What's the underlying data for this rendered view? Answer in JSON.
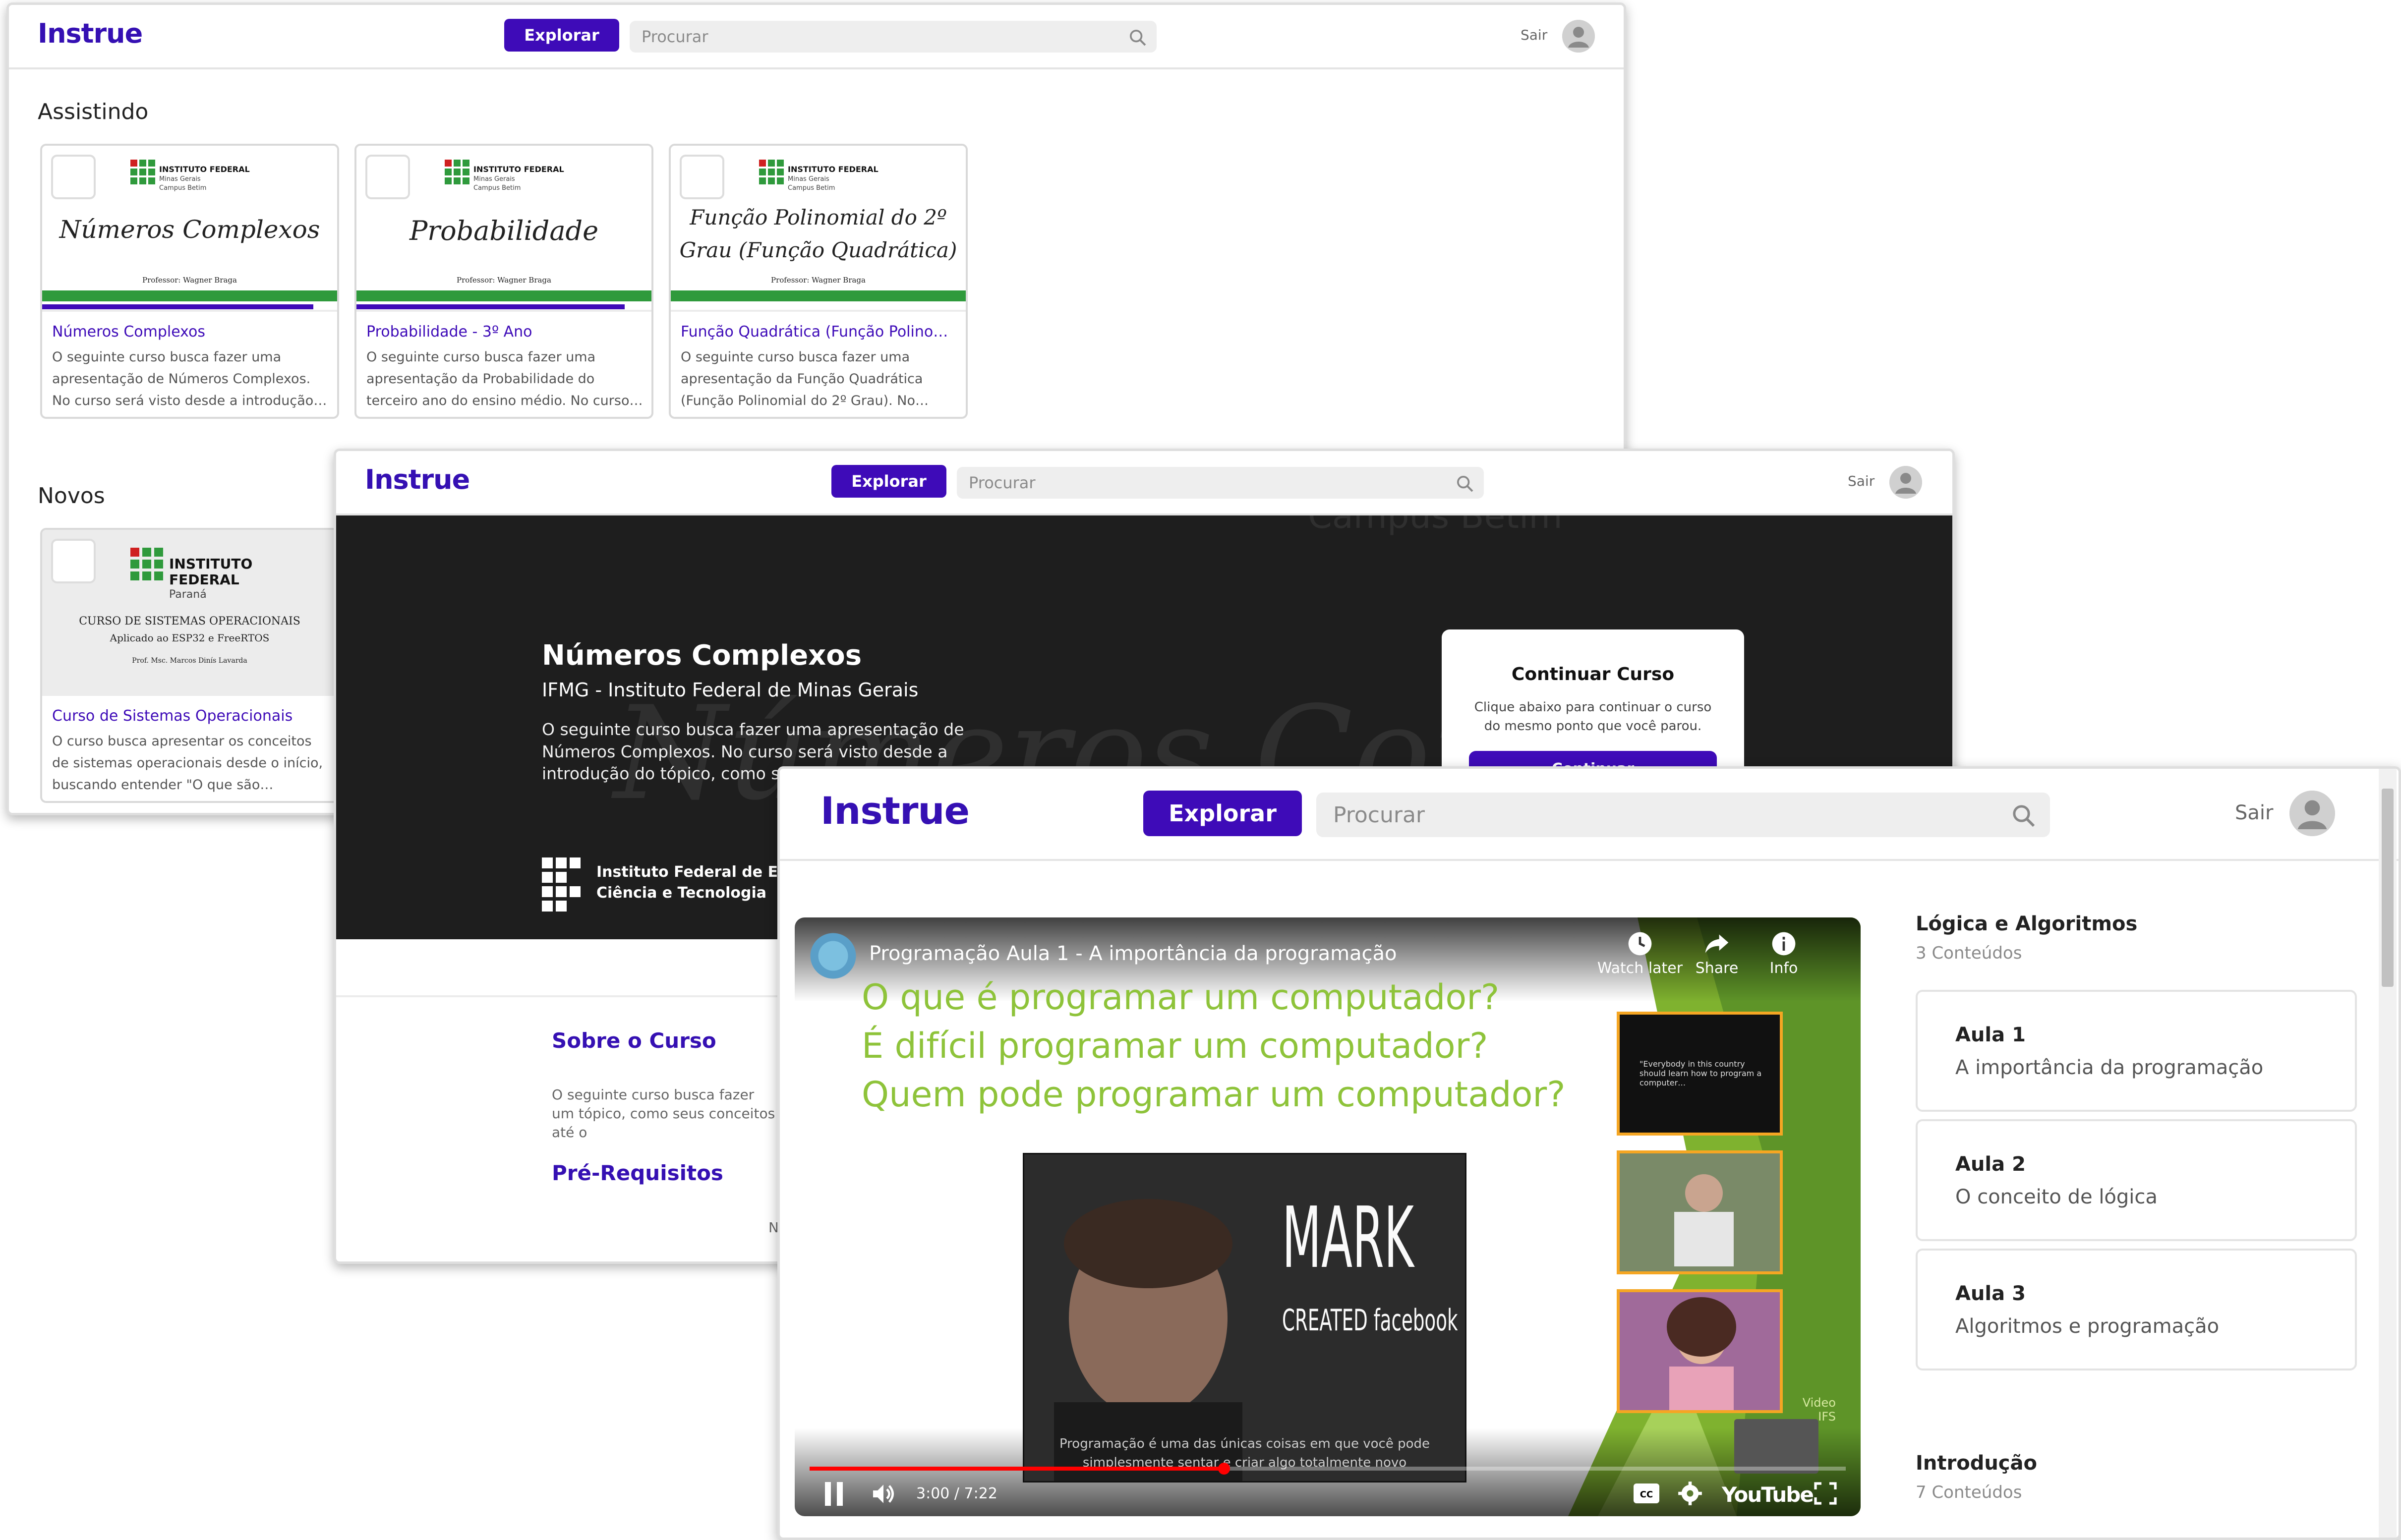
{
  "app": {
    "brand": "Instrue",
    "explore_label": "Explorar",
    "search_placeholder": "Procurar",
    "logout_label": "Sair"
  },
  "home": {
    "watching_title": "Assistindo",
    "new_title": "Novos",
    "watching": [
      {
        "thumb_title": "Números Complexos",
        "thumb_prof": "Professor: Wagner Braga",
        "title": "Números Complexos",
        "description": "O seguinte curso busca fazer uma apresentação de Números Complexos. No curso será visto desde a introdução…",
        "progress": 0.92
      },
      {
        "thumb_title": "Probabilidade",
        "thumb_prof": "Professor: Wagner Braga",
        "title": "Probabilidade - 3º Ano",
        "description": "O seguinte curso busca fazer uma apresentação da Probabilidade do terceiro ano do ensino médio. No curso…",
        "progress": 0.91
      },
      {
        "thumb_title": "Função Polinomial do 2º Grau (Função Quadrática)",
        "thumb_prof": "Professor: Wagner Braga",
        "title": "Função Quadrática (Função Polinomial do 2º Grau)",
        "description": "O seguinte curso busca fazer uma apresentação da Função Quadrática (Função Polinomial do 2º Grau). No…",
        "progress": 0.0
      }
    ],
    "thumb_institution": [
      "INSTITUTO FEDERAL",
      "Minas Gerais",
      "Campus Betim"
    ],
    "new": [
      {
        "thumb_institution": [
          "INSTITUTO",
          "FEDERAL",
          "Paraná"
        ],
        "thumb_title": "CURSO DE SISTEMAS OPERACIONAIS",
        "thumb_subtitle": "Aplicado ao ESP32 e FreeRTOS",
        "thumb_prof": "Prof. Msc. Marcos Dinís Lavarda",
        "title": "Curso de Sistemas Operacionais",
        "description": "O curso busca apresentar os conceitos de sistemas operacionais desde o início, buscando entender \"O que são…"
      }
    ]
  },
  "course": {
    "title": "Números Complexos",
    "institution_line": "IFMG - Instituto Federal de Minas Gerais",
    "description": "O seguinte curso busca fazer uma apresentação de Números Complexos. No curso será visto desde a introdução do tópico, como s",
    "institution_name_line1": "Instituto Federal de Educ",
    "institution_name_line2": "Ciência e Tecnologia",
    "ghost_text": "Números Comp",
    "ghost_campus": "Campus Betim",
    "continue_card": {
      "title": "Continuar Curso",
      "text": "Clique abaixo para continuar o curso do mesmo ponto que você parou.",
      "button": "Continuar"
    },
    "about_title": "Sobre o Curso",
    "about_text": "O seguinte curso busca fazer um tópico, como seus conceitos até o",
    "prereq_title": "Pré-Requisitos",
    "prereq_text": "N"
  },
  "player": {
    "video_title": "Programação Aula 1 - A importância da programação",
    "questions": [
      "O que é programar um computador?",
      "É difícil programar um computador?",
      "Quem pode programar um computador?"
    ],
    "overlay_text": "MARK",
    "overlay_sub": "CREATED facebook",
    "subtitle": "Programação é uma das únicas coisas em que você pode simplesmente sentar e criar algo totalmente novo",
    "thumb1_text": "\"Everybody in this country should learn how to program a computer…",
    "actions": [
      "Watch later",
      "Share",
      "Info"
    ],
    "time": "3:00 / 7:22",
    "progress": 0.4,
    "youtube_label": "YouTube",
    "channel_badge": "Video IFS",
    "module": {
      "title": "Lógica e Algoritmos",
      "count": "3 Conteúdos",
      "lessons": [
        {
          "title": "Aula 1",
          "subtitle": "A importância da programação"
        },
        {
          "title": "Aula 2",
          "subtitle": "O conceito de lógica"
        },
        {
          "title": "Aula 3",
          "subtitle": "Algoritmos e programação"
        }
      ]
    },
    "next_module": {
      "title": "Introdução",
      "count": "7 Conteúdos"
    }
  },
  "colors": {
    "brand": "#3510b3",
    "button": "#3e0bb8",
    "hero_bg": "#1e1e1e",
    "if_green": "#2f9a3c",
    "video_green": "#8ec33a",
    "youtube_red": "#ff0000"
  }
}
